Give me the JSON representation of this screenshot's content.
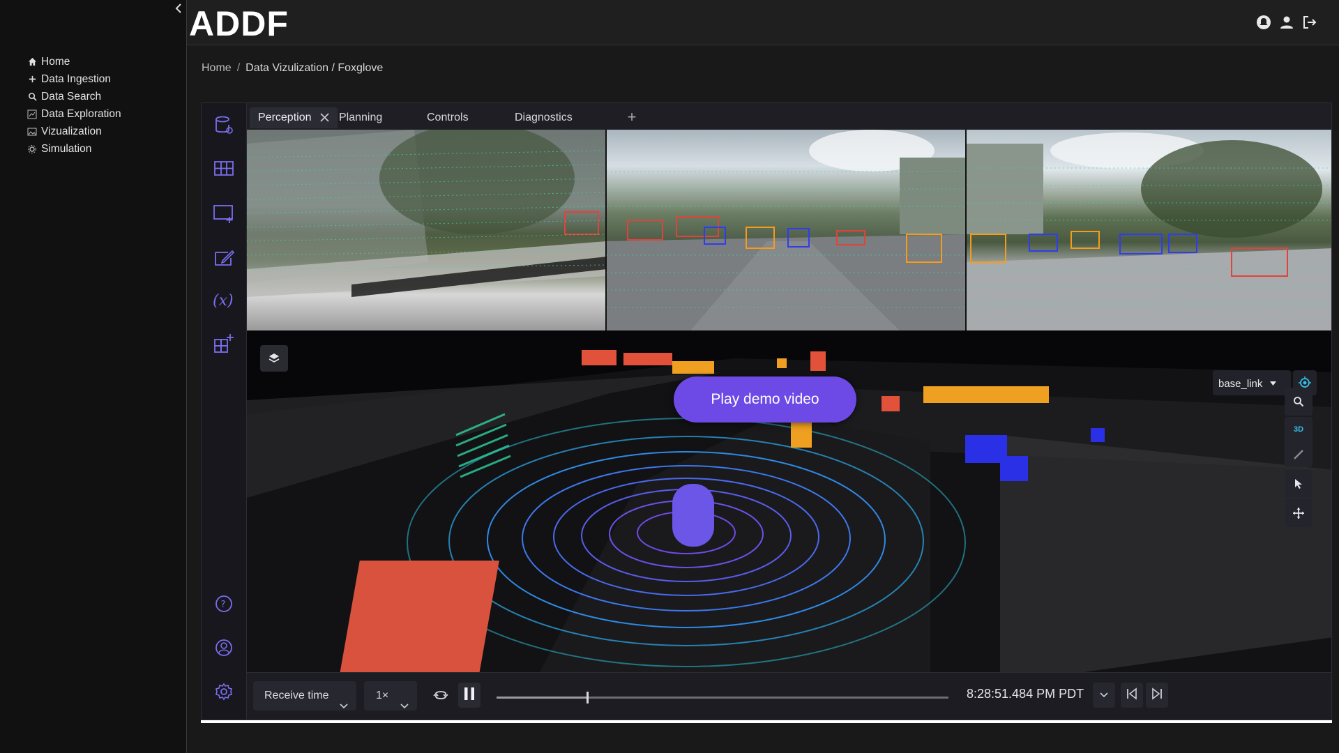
{
  "app": {
    "title": "ADDF"
  },
  "nav": {
    "items": [
      {
        "label": "Home",
        "icon": "home-icon"
      },
      {
        "label": "Data Ingestion",
        "icon": "plus-icon"
      },
      {
        "label": "Data Search",
        "icon": "search-icon"
      },
      {
        "label": "Data Exploration",
        "icon": "chart-icon"
      },
      {
        "label": "Vizualization",
        "icon": "image-icon"
      },
      {
        "label": "Simulation",
        "icon": "gear-icon"
      }
    ]
  },
  "header": {
    "icons": [
      "notification-icon",
      "user-icon",
      "logout-icon"
    ]
  },
  "breadcrumb": {
    "home": "Home",
    "separator": "/",
    "current": "Data Vizulization / Foxglove"
  },
  "foxglove": {
    "tabs": [
      {
        "label": "Perception",
        "active": true
      },
      {
        "label": "Planning"
      },
      {
        "label": "Controls"
      },
      {
        "label": "Diagnostics"
      }
    ],
    "tab_add": "+",
    "rail_icons": [
      "data-source-icon",
      "layout-icon",
      "add-panel-icon",
      "edit-icon",
      "variables-icon",
      "extensions-icon",
      "help-icon",
      "account-icon",
      "settings-icon"
    ],
    "view3d": {
      "play_demo_label": "Play demo video",
      "frame": "base_link",
      "mode": "3D"
    },
    "playback": {
      "time_mode": "Receive time",
      "speed": "1×",
      "progress": 0.2,
      "timestamp": "8:28:51.484 PM PDT"
    }
  },
  "colors": {
    "accent": "#6d4ae6",
    "rail_icon": "#7b6ff0",
    "target": "#34c0e6"
  }
}
